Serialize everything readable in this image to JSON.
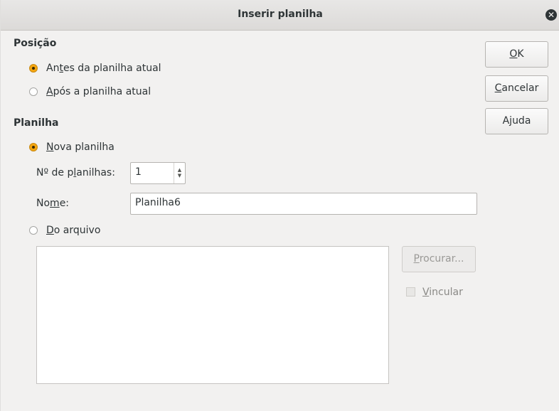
{
  "dialog": {
    "title": "Inserir planilha"
  },
  "position": {
    "heading": "Posição",
    "before": {
      "label_pre": "An",
      "label_mnemonic": "t",
      "label_post": "es da planilha atual",
      "checked": true
    },
    "after": {
      "label_pre": "",
      "label_mnemonic": "A",
      "label_post": "pós a planilha atual",
      "checked": false
    }
  },
  "sheet": {
    "heading": "Planilha",
    "new_sheet": {
      "label_pre": "",
      "label_mnemonic": "N",
      "label_post": "ova planilha",
      "checked": true
    },
    "count": {
      "label_pre": "Nº de p",
      "label_mnemonic": "l",
      "label_post": "anilhas:",
      "value": "1"
    },
    "name": {
      "label_pre": "No",
      "label_mnemonic": "m",
      "label_post": "e:",
      "value": "Planilha6"
    },
    "from_file": {
      "label_pre": "",
      "label_mnemonic": "D",
      "label_post": "o arquivo",
      "checked": false
    },
    "browse": {
      "label_pre": "",
      "label_mnemonic": "P",
      "label_post": "rocurar..."
    },
    "link": {
      "label_pre": "",
      "label_mnemonic": "V",
      "label_post": "incular",
      "checked": false
    }
  },
  "buttons": {
    "ok": {
      "label_pre": "",
      "label_mnemonic": "O",
      "label_post": "K"
    },
    "cancel": {
      "label_pre": "",
      "label_mnemonic": "C",
      "label_post": "ancelar"
    },
    "help": {
      "label_pre": "A",
      "label_mnemonic": "j",
      "label_post": "uda"
    }
  },
  "icons": {
    "close": "close-icon",
    "close_glyph": "✕",
    "spin_up_glyph": "▲",
    "spin_down_glyph": "▼"
  },
  "colors": {
    "accent_radio": "#f5a60f",
    "dialog_bg": "#f2f1f0"
  }
}
